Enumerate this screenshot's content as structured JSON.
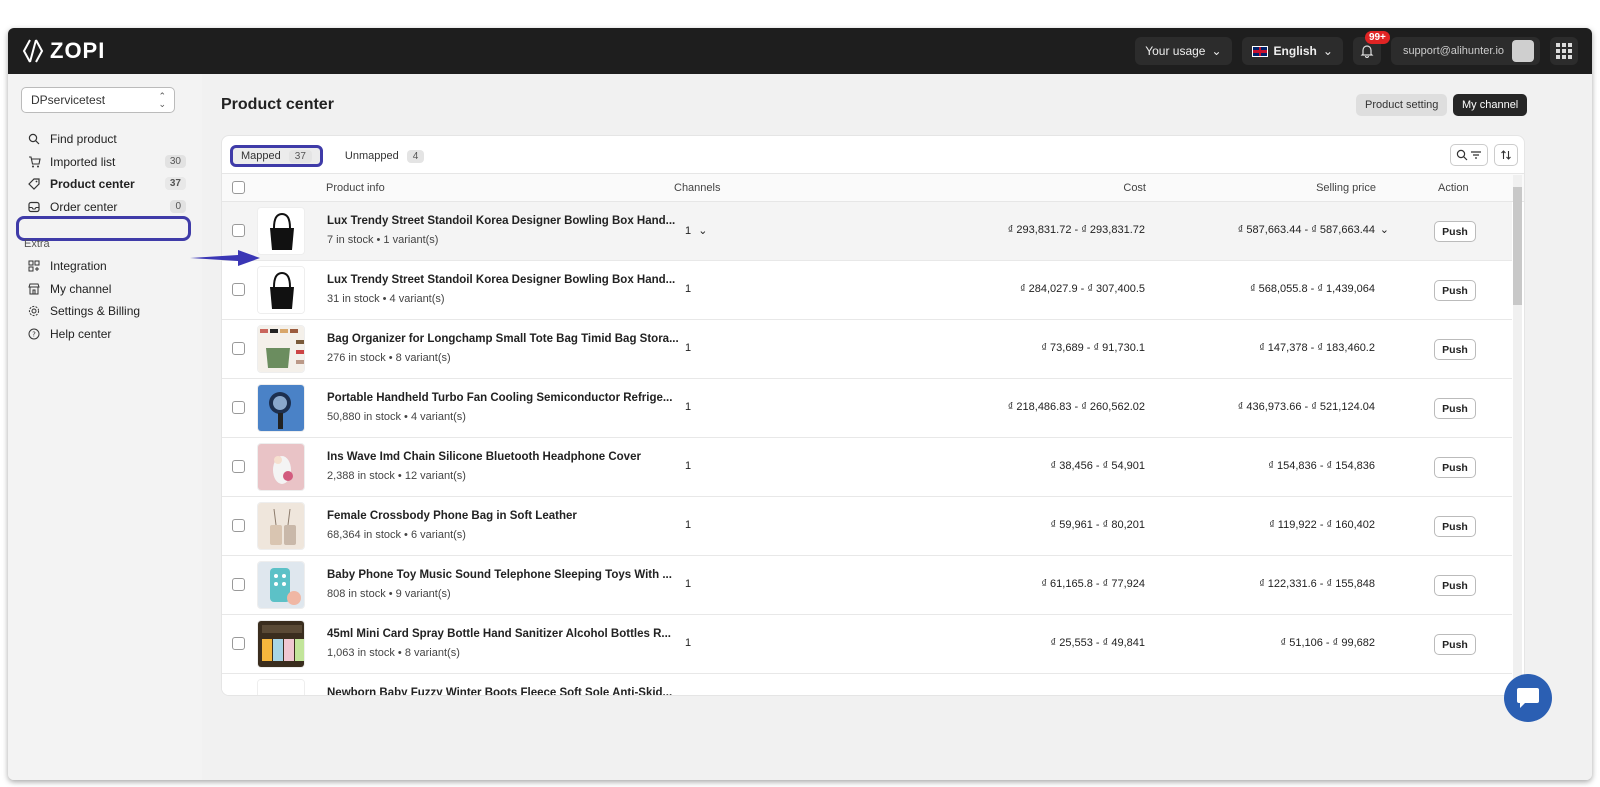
{
  "header": {
    "logo_text": "ZOPI",
    "usage_label": "Your usage",
    "language_label": "English",
    "notification_count": "99+",
    "email": "support@alihunter.io"
  },
  "sidebar": {
    "store": "DPservicetest",
    "items": [
      {
        "label": "Find product",
        "count": "",
        "icon": "search-icon"
      },
      {
        "label": "Imported list",
        "count": "30",
        "icon": "cart-icon"
      },
      {
        "label": "Product center",
        "count": "37",
        "icon": "tag-icon"
      },
      {
        "label": "Order center",
        "count": "0",
        "icon": "inbox-icon"
      }
    ],
    "extra_label": "Extra",
    "extra_items": [
      {
        "label": "Integration",
        "icon": "integration-icon"
      },
      {
        "label": "My channel",
        "icon": "store-icon"
      },
      {
        "label": "Settings & Billing",
        "icon": "gear-icon"
      },
      {
        "label": "Help center",
        "icon": "help-icon"
      }
    ]
  },
  "main": {
    "title": "Product center",
    "product_setting_label": "Product setting",
    "my_channel_label": "My channel",
    "tabs": [
      {
        "label": "Mapped",
        "count": "37"
      },
      {
        "label": "Unmapped",
        "count": "4"
      }
    ],
    "columns": {
      "product_info": "Product info",
      "channels": "Channels",
      "cost": "Cost",
      "selling_price": "Selling price",
      "action": "Action"
    },
    "push_label": "Push",
    "rows": [
      {
        "name": "Lux Trendy Street Standoil Korea Designer Bowling Box Hand...",
        "meta": "7 in stock  •  1 variant(s)",
        "channels": "1",
        "cost": "₫ 293,831.72 - ₫ 293,831.72",
        "selling": "₫ 587,663.44 - ₫ 587,663.44"
      },
      {
        "name": "Lux Trendy Street Standoil Korea Designer Bowling Box Hand...",
        "meta": "31 in stock  •  4 variant(s)",
        "channels": "1",
        "cost": "₫ 284,027.9 - ₫ 307,400.5",
        "selling": "₫ 568,055.8 - ₫ 1,439,064"
      },
      {
        "name": "Bag Organizer for Longchamp Small Tote Bag Timid Bag Stora...",
        "meta": "276 in stock  •  8 variant(s)",
        "channels": "1",
        "cost": "₫ 73,689 - ₫ 91,730.1",
        "selling": "₫ 147,378 - ₫ 183,460.2"
      },
      {
        "name": "Portable Handheld Turbo Fan Cooling Semiconductor Refrige...",
        "meta": "50,880 in stock  •  4 variant(s)",
        "channels": "1",
        "cost": "₫ 218,486.83 - ₫ 260,562.02",
        "selling": "₫ 436,973.66 - ₫ 521,124.04"
      },
      {
        "name": "Ins Wave Imd Chain Silicone Bluetooth Headphone Cover",
        "meta": "2,388 in stock  •  12 variant(s)",
        "channels": "1",
        "cost": "₫ 38,456 - ₫ 54,901",
        "selling": "₫ 154,836 - ₫ 154,836"
      },
      {
        "name": "Female Crossbody Phone Bag in Soft Leather",
        "meta": "68,364 in stock  •  6 variant(s)",
        "channels": "1",
        "cost": "₫ 59,961 - ₫ 80,201",
        "selling": "₫ 119,922 - ₫ 160,402"
      },
      {
        "name": "Baby Phone Toy Music Sound Telephone Sleeping Toys With ...",
        "meta": "808 in stock  •  9 variant(s)",
        "channels": "1",
        "cost": "₫ 61,165.8 - ₫ 77,924",
        "selling": "₫ 122,331.6 - ₫ 155,848"
      },
      {
        "name": "45ml Mini Card Spray Bottle Hand Sanitizer Alcohol Bottles R...",
        "meta": "1,063 in stock  •  8 variant(s)",
        "channels": "1",
        "cost": "₫ 25,553 - ₫ 49,841",
        "selling": "₫ 51,106 - ₫ 99,682"
      },
      {
        "name": "Newborn Baby Fuzzy Winter Boots Fleece Soft Sole Anti-Skid...",
        "meta": "",
        "channels": "",
        "cost": "",
        "selling": ""
      }
    ]
  },
  "colors": {
    "highlight": "#3f3ba8",
    "topbar": "#1e1e1e",
    "chat": "#2b5fb3"
  }
}
